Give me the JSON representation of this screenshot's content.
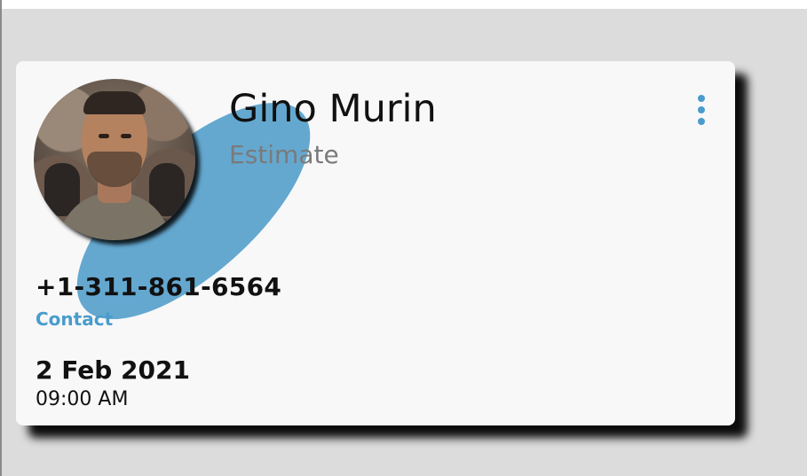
{
  "contact": {
    "name": "Gino Murin",
    "status": "Estimate",
    "phone": "+1-311-861-6564",
    "contact_link": "Contact",
    "date": "2 Feb 2021",
    "time": "09:00 AM"
  },
  "colors": {
    "accent": "#4a9ccc",
    "blob": "#64a8d0",
    "card_background": "#f8f8f9",
    "page_background": "#dcdcdc"
  },
  "icons": {
    "menu": "more-vertical-icon"
  }
}
